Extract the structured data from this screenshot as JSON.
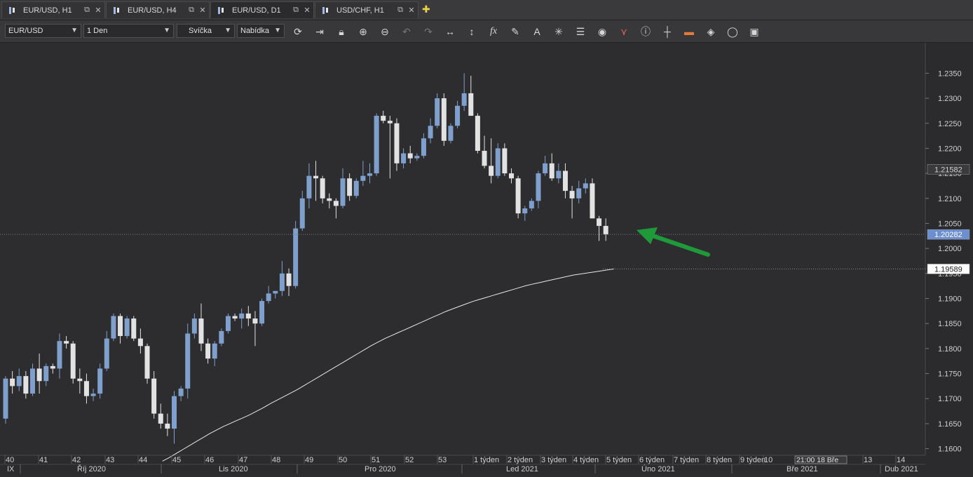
{
  "tabs": [
    {
      "label": "EUR/USD, H1"
    },
    {
      "label": "EUR/USD, H4"
    },
    {
      "label": "EUR/USD, D1"
    },
    {
      "label": "USD/CHF, H1"
    }
  ],
  "toolbar": {
    "symbol": "EUR/USD",
    "timeframe": "1 Den",
    "chart_type": "Svíčka",
    "price_side": "Nabídka",
    "icons": [
      "refresh-icon",
      "autoscroll-icon",
      "lock-icon",
      "zoom-in-icon",
      "zoom-out-icon",
      "undo-icon",
      "redo-icon",
      "horizontal-resize-icon",
      "vertical-resize-icon",
      "fx-indicator-icon",
      "pencil-icon",
      "text-tool-icon",
      "crosshair-star-icon",
      "layers-icon",
      "eye-icon",
      "alerts-icon",
      "info-icon",
      "crosshair-icon",
      "ruler-icon",
      "paint-bucket-icon",
      "circle-icon",
      "save-icon"
    ]
  },
  "price_axis": {
    "ticks": [
      "1.2350",
      "1.2300",
      "1.2250",
      "1.2200",
      "1.2150",
      "1.2100",
      "1.2050",
      "1.2000",
      "1.1950",
      "1.1900",
      "1.1850",
      "1.1800",
      "1.1750",
      "1.1700",
      "1.1650",
      "1.1600"
    ],
    "marker_high": "1.21582",
    "marker_current": "1.20282",
    "marker_ma": "1.19589"
  },
  "time_axis": {
    "weeks": [
      "40",
      "41",
      "42",
      "43",
      "44",
      "45",
      "46",
      "47",
      "48",
      "49",
      "50",
      "51",
      "52",
      "53",
      "1 týden",
      "2 týden",
      "3 týden",
      "4 týden",
      "5 týden",
      "6 týden",
      "7 týden",
      "8 týden",
      "9 týden",
      "10",
      "21:00 18 Bře",
      "13",
      "14"
    ],
    "months": [
      "IX",
      "Říj 2020",
      "Lis 2020",
      "Pro 2020",
      "Led 2021",
      "Úno 2021",
      "Bře 2021",
      "Dub 2021"
    ]
  },
  "chart_data": {
    "type": "candlestick",
    "ylim": [
      1.157,
      1.238
    ],
    "candles": [
      [
        1.166,
        1.1745,
        1.165,
        1.174
      ],
      [
        1.174,
        1.1755,
        1.171,
        1.1725
      ],
      [
        1.1725,
        1.176,
        1.1715,
        1.1745
      ],
      [
        1.1745,
        1.1755,
        1.17,
        1.171
      ],
      [
        1.171,
        1.177,
        1.1705,
        1.176
      ],
      [
        1.176,
        1.179,
        1.171,
        1.1735
      ],
      [
        1.1735,
        1.177,
        1.1725,
        1.1765
      ],
      [
        1.1765,
        1.177,
        1.175,
        1.176
      ],
      [
        1.176,
        1.183,
        1.174,
        1.1815
      ],
      [
        1.1815,
        1.1825,
        1.18,
        1.181
      ],
      [
        1.181,
        1.1815,
        1.173,
        1.174
      ],
      [
        1.174,
        1.176,
        1.171,
        1.1735
      ],
      [
        1.1735,
        1.175,
        1.169,
        1.1705
      ],
      [
        1.1705,
        1.172,
        1.1695,
        1.171
      ],
      [
        1.171,
        1.177,
        1.17,
        1.176
      ],
      [
        1.176,
        1.1835,
        1.1755,
        1.182
      ],
      [
        1.182,
        1.187,
        1.1815,
        1.1865
      ],
      [
        1.1865,
        1.187,
        1.181,
        1.1825
      ],
      [
        1.1825,
        1.1865,
        1.182,
        1.186
      ],
      [
        1.186,
        1.1865,
        1.1815,
        1.182
      ],
      [
        1.182,
        1.184,
        1.179,
        1.1805
      ],
      [
        1.1805,
        1.181,
        1.173,
        1.174
      ],
      [
        1.174,
        1.1755,
        1.166,
        1.167
      ],
      [
        1.167,
        1.169,
        1.164,
        1.165
      ],
      [
        1.165,
        1.167,
        1.1625,
        1.164
      ],
      [
        1.164,
        1.1715,
        1.161,
        1.1705
      ],
      [
        1.1705,
        1.1725,
        1.1695,
        1.172
      ],
      [
        1.172,
        1.185,
        1.17,
        1.183
      ],
      [
        1.183,
        1.187,
        1.182,
        1.186
      ],
      [
        1.186,
        1.189,
        1.1795,
        1.181
      ],
      [
        1.181,
        1.182,
        1.177,
        1.178
      ],
      [
        1.178,
        1.1815,
        1.1765,
        1.181
      ],
      [
        1.181,
        1.184,
        1.1805,
        1.1835
      ],
      [
        1.1835,
        1.187,
        1.183,
        1.1865
      ],
      [
        1.1865,
        1.187,
        1.1855,
        1.186
      ],
      [
        1.186,
        1.188,
        1.184,
        1.187
      ],
      [
        1.187,
        1.1885,
        1.1845,
        1.186
      ],
      [
        1.186,
        1.1875,
        1.1805,
        1.185
      ],
      [
        1.185,
        1.19,
        1.1845,
        1.1895
      ],
      [
        1.1895,
        1.1925,
        1.189,
        1.191
      ],
      [
        1.191,
        1.1915,
        1.19,
        1.1915
      ],
      [
        1.1915,
        1.1975,
        1.1905,
        1.195
      ],
      [
        1.195,
        1.196,
        1.1905,
        1.1925
      ],
      [
        1.1925,
        1.2055,
        1.192,
        1.204
      ],
      [
        1.204,
        1.2115,
        1.2035,
        1.21
      ],
      [
        1.21,
        1.217,
        1.208,
        1.2145
      ],
      [
        1.2145,
        1.2175,
        1.2095,
        1.214
      ],
      [
        1.214,
        1.2145,
        1.209,
        1.21
      ],
      [
        1.21,
        1.211,
        1.208,
        1.2095
      ],
      [
        1.2095,
        1.21,
        1.206,
        1.2085
      ],
      [
        1.2085,
        1.216,
        1.208,
        1.214
      ],
      [
        1.214,
        1.215,
        1.2095,
        1.2105
      ],
      [
        1.2105,
        1.214,
        1.21,
        1.2135
      ],
      [
        1.2135,
        1.2175,
        1.2125,
        1.2145
      ],
      [
        1.2145,
        1.217,
        1.213,
        1.215
      ],
      [
        1.215,
        1.227,
        1.2145,
        1.2265
      ],
      [
        1.2265,
        1.2275,
        1.225,
        1.2255
      ],
      [
        1.2255,
        1.2265,
        1.214,
        1.225
      ],
      [
        1.225,
        1.226,
        1.2155,
        1.217
      ],
      [
        1.217,
        1.22,
        1.216,
        1.219
      ],
      [
        1.219,
        1.2205,
        1.217,
        1.218
      ],
      [
        1.218,
        1.219,
        1.2175,
        1.2185
      ],
      [
        1.2185,
        1.223,
        1.218,
        1.222
      ],
      [
        1.222,
        1.226,
        1.221,
        1.2245
      ],
      [
        1.2245,
        1.231,
        1.224,
        1.23
      ],
      [
        1.23,
        1.231,
        1.2205,
        1.2215
      ],
      [
        1.2215,
        1.225,
        1.221,
        1.2245
      ],
      [
        1.2245,
        1.2295,
        1.224,
        1.2285
      ],
      [
        1.2285,
        1.235,
        1.2275,
        1.231
      ],
      [
        1.231,
        1.2345,
        1.2265,
        1.2265
      ],
      [
        1.2265,
        1.227,
        1.219,
        1.2195
      ],
      [
        1.2195,
        1.2225,
        1.216,
        1.2165
      ],
      [
        1.2165,
        1.222,
        1.213,
        1.2145
      ],
      [
        1.2145,
        1.221,
        1.214,
        1.22
      ],
      [
        1.22,
        1.221,
        1.2145,
        1.215
      ],
      [
        1.215,
        1.216,
        1.213,
        1.214
      ],
      [
        1.214,
        1.2145,
        1.206,
        1.207
      ],
      [
        1.207,
        1.2085,
        1.2055,
        1.208
      ],
      [
        1.208,
        1.21,
        1.2075,
        1.2095
      ],
      [
        1.2095,
        1.2155,
        1.208,
        1.215
      ],
      [
        1.215,
        1.2185,
        1.2145,
        1.217
      ],
      [
        1.217,
        1.219,
        1.2135,
        1.214
      ],
      [
        1.214,
        1.217,
        1.213,
        1.2155
      ],
      [
        1.2155,
        1.217,
        1.21,
        1.2115
      ],
      [
        1.2115,
        1.2125,
        1.206,
        1.21
      ],
      [
        1.21,
        1.2135,
        1.209,
        1.212
      ],
      [
        1.212,
        1.214,
        1.211,
        1.213
      ],
      [
        1.213,
        1.214,
        1.206,
        1.206
      ],
      [
        1.206,
        1.2065,
        1.2015,
        1.2045
      ],
      [
        1.2045,
        1.206,
        1.2015,
        1.2028
      ]
    ],
    "moving_average": [
      1.1575,
      1.1582,
      1.159,
      1.1598,
      1.1606,
      1.1614,
      1.1622,
      1.163,
      1.1637,
      1.1644,
      1.165,
      1.1656,
      1.1662,
      1.1668,
      1.1675,
      1.1682,
      1.169,
      1.1697,
      1.1704,
      1.1711,
      1.1718,
      1.1726,
      1.1734,
      1.1742,
      1.175,
      1.1758,
      1.1766,
      1.1774,
      1.1782,
      1.179,
      1.1798,
      1.1806,
      1.1813,
      1.182,
      1.1826,
      1.1832,
      1.1838,
      1.1844,
      1.185,
      1.1856,
      1.1862,
      1.1868,
      1.1874,
      1.1879,
      1.1884,
      1.1889,
      1.1894,
      1.1898,
      1.1902,
      1.1906,
      1.191,
      1.1914,
      1.1918,
      1.1922,
      1.1926,
      1.1929,
      1.1932,
      1.1935,
      1.1938,
      1.1941,
      1.1944,
      1.1947,
      1.1949,
      1.1951,
      1.1953,
      1.1955,
      1.1957,
      1.1959
    ],
    "colors": {
      "bull": "#7f9fcc",
      "bear": "#e2e2e2",
      "ma": "#e8e8e8",
      "arrow": "#1f9a3a",
      "current_marker": "#6d8fd0"
    }
  }
}
